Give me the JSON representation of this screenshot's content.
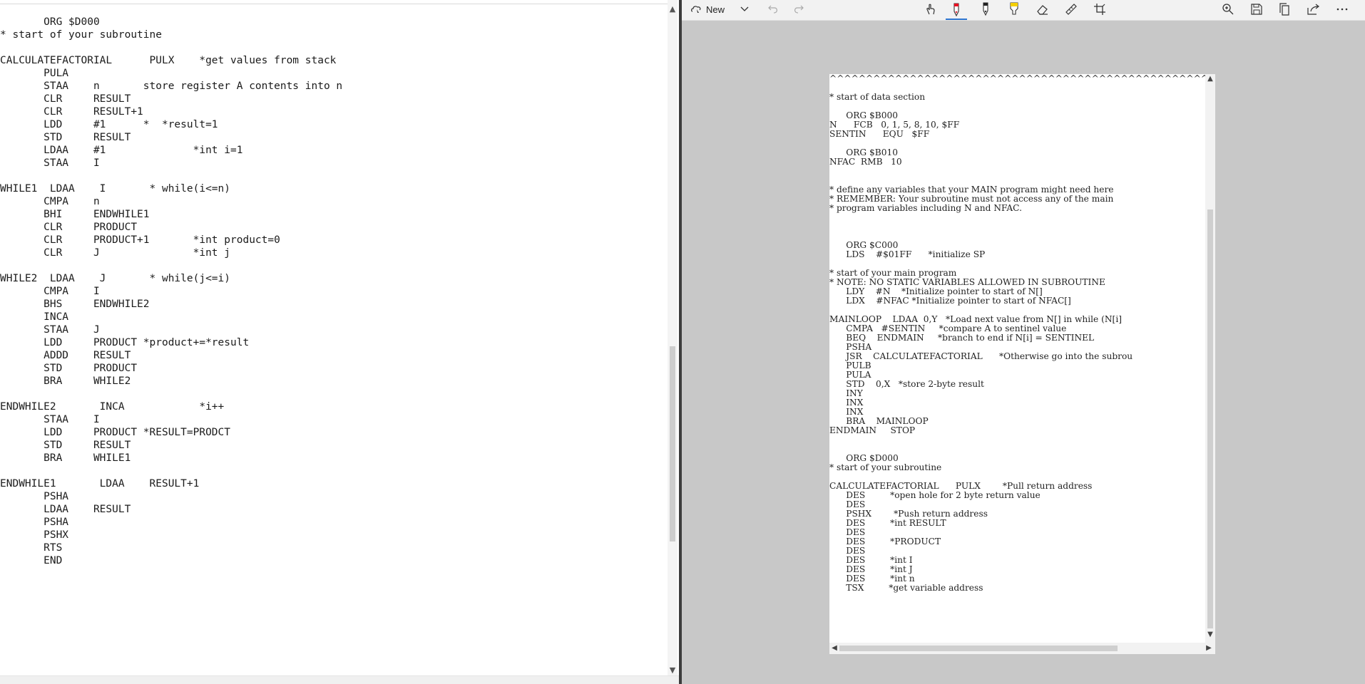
{
  "left_editor": {
    "code": "       ORG $D000\n* start of your subroutine\n\nCALCULATEFACTORIAL      PULX    *get values from stack\n       PULA\n       STAA    n       store register A contents into n\n       CLR     RESULT\n       CLR     RESULT+1\n       LDD     #1      *  *result=1\n       STD     RESULT\n       LDAA    #1              *int i=1\n       STAA    I\n\nWHILE1  LDAA    I       * while(i<=n)\n       CMPA    n\n       BHI     ENDWHILE1\n       CLR     PRODUCT\n       CLR     PRODUCT+1       *int product=0\n       CLR     J               *int j\n\nWHILE2  LDAA    J       * while(j<=i)\n       CMPA    I\n       BHS     ENDWHILE2\n       INCA\n       STAA    J\n       LDD     PRODUCT *product+=*result\n       ADDD    RESULT\n       STD     PRODUCT\n       BRA     WHILE2\n\nENDWHILE2       INCA            *i++\n       STAA    I\n       LDD     PRODUCT *RESULT=PRODCT\n       STD     RESULT\n       BRA     WHILE1\n\nENDWHILE1       LDAA    RESULT+1\n       PSHA\n       LDAA    RESULT\n       PSHA\n       PSHX\n       RTS\n       END"
  },
  "viewer": {
    "toolbar": {
      "new_label": "New",
      "icons": [
        "sketch-icon",
        "chevron-down-icon",
        "undo-icon",
        "redo-icon",
        "touch-writing-icon",
        "ballpoint-pen-icon",
        "pencil-icon",
        "highlighter-icon",
        "eraser-icon",
        "ruler-icon",
        "crop-icon",
        "zoom-in-icon",
        "save-icon",
        "copy-icon",
        "share-icon",
        "more-icon"
      ],
      "accent_color": "#2e76d0",
      "pen_color": "#e81123",
      "highlighter_color": "#f5d000"
    },
    "document_text": "^^^^^^^^^^^^^^^^^^^^^^^^^^^^^^^^^^^^^^^^^^^^^^^^^^^^\n\n* start of data section\n\n      ORG $B000\nN      FCB   0, 1, 5, 8, 10, $FF\nSENTIN      EQU   $FF\n\n      ORG $B010\nNFAC  RMB   10\n\n\n* define any variables that your MAIN program might need here\n* REMEMBER: Your subroutine must not access any of the main\n* program variables including N and NFAC.\n\n\n\n      ORG $C000\n      LDS    #$01FF      *initialize SP\n\n* start of your main program\n* NOTE: NO STATIC VARIABLES ALLOWED IN SUBROUTINE\n      LDY    #N    *Initialize pointer to start of N[]\n      LDX    #NFAC *Initialize pointer to start of NFAC[]\n\nMAINLOOP    LDAA  0,Y   *Load next value from N[] in while (N[i]\n      CMPA   #SENTIN     *compare A to sentinel value\n      BEQ    ENDMAIN     *branch to end if N[i] = SENTINEL\n      PSHA\n      JSR    CALCULATEFACTORIAL      *Otherwise go into the subrou\n      PULB\n      PULA\n      STD    0,X   *store 2-byte result\n      INY\n      INX\n      INX\n      BRA    MAINLOOP\nENDMAIN     STOP\n\n\n      ORG $D000\n* start of your subroutine\n\nCALCULATEFACTORIAL      PULX        *Pull return address\n      DES         *open hole for 2 byte return value\n      DES\n      PSHX        *Push return address\n      DES         *int RESULT\n      DES\n      DES         *PRODUCT\n      DES\n      DES         *int I\n      DES         *int J\n      DES         *int n\n      TSX         *get variable address"
  }
}
